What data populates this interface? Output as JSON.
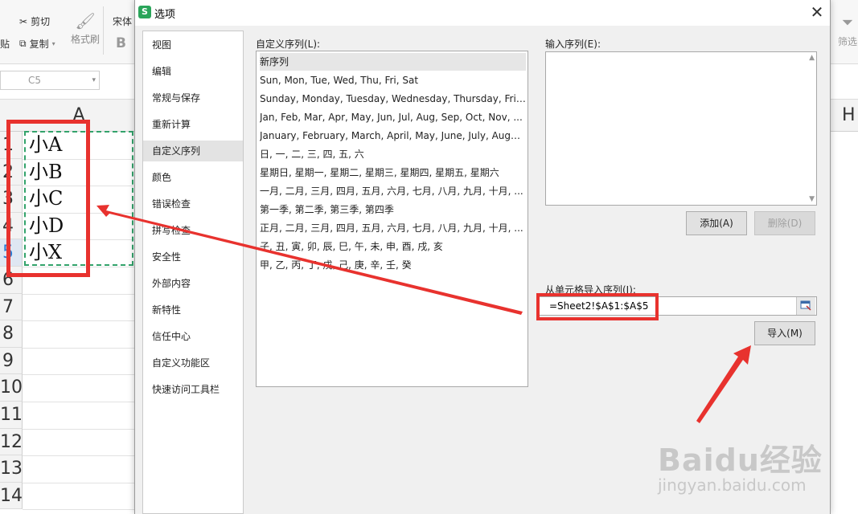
{
  "ribbon": {
    "cut_label": "剪切",
    "copy_label": "复制",
    "format_painter_label": "格式刷",
    "font_name": "宋体",
    "bold_glyph": "B",
    "filter_label": "筛选",
    "paste_fragment": "贴"
  },
  "namebox": {
    "value": "C5"
  },
  "sheet": {
    "column_a": "A",
    "column_h": "H",
    "rows": [
      {
        "num": "1",
        "value": "小A"
      },
      {
        "num": "2",
        "value": "小B"
      },
      {
        "num": "3",
        "value": "小C"
      },
      {
        "num": "4",
        "value": "小D"
      },
      {
        "num": "5",
        "value": "小X"
      },
      {
        "num": "6",
        "value": ""
      },
      {
        "num": "7",
        "value": ""
      },
      {
        "num": "8",
        "value": ""
      },
      {
        "num": "9",
        "value": ""
      },
      {
        "num": "10",
        "value": ""
      },
      {
        "num": "11",
        "value": ""
      },
      {
        "num": "12",
        "value": ""
      },
      {
        "num": "13",
        "value": ""
      },
      {
        "num": "14",
        "value": ""
      }
    ]
  },
  "dialog": {
    "title": "选项",
    "app_icon": "S",
    "close_glyph": "✕",
    "nav": [
      {
        "label": "视图"
      },
      {
        "label": "编辑"
      },
      {
        "label": "常规与保存"
      },
      {
        "label": "重新计算"
      },
      {
        "label": "自定义序列",
        "active": true
      },
      {
        "label": "颜色"
      },
      {
        "label": "错误检查"
      },
      {
        "label": "拼写检查"
      },
      {
        "label": "安全性"
      },
      {
        "label": "外部内容"
      },
      {
        "label": "新特性"
      },
      {
        "label": "信任中心"
      },
      {
        "label": "自定义功能区"
      },
      {
        "label": "快速访问工具栏"
      }
    ],
    "custom_lists_label": "自定义序列(L):",
    "custom_lists": [
      "新序列",
      "Sun, Mon, Tue, Wed, Thu, Fri, Sat",
      "Sunday, Monday, Tuesday, Wednesday, Thursday, Frid...",
      "Jan, Feb, Mar, Apr, May, Jun, Jul, Aug, Sep, Oct, Nov, ...",
      "January, February, March, April, May, June, July, Augus...",
      "日, 一, 二, 三, 四, 五, 六",
      "星期日, 星期一, 星期二, 星期三, 星期四, 星期五, 星期六",
      "一月, 二月, 三月, 四月, 五月, 六月, 七月, 八月, 九月, 十月, ...",
      "第一季, 第二季, 第三季, 第四季",
      "正月, 二月, 三月, 四月, 五月, 六月, 七月, 八月, 九月, 十月, ...",
      "子, 丑, 寅, 卯, 辰, 巳, 午, 未, 申, 酉, 戌, 亥",
      "甲, 乙, 丙, 丁, 戊, 己, 庚, 辛, 壬, 癸"
    ],
    "entries_label": "输入序列(E):",
    "add_button": "添加(A)",
    "delete_button": "删除(D)",
    "import_label": "从单元格导入序列(I):",
    "import_ref": "=Sheet2!$A$1:$A$5",
    "import_button": "导入(M)"
  },
  "watermark": {
    "main": "Baidu经验",
    "sub": "jingyan.baidu.com"
  },
  "colors": {
    "annotation_red": "#e8322e",
    "selection_green": "#33a36b",
    "wps_green": "#2aa55a"
  }
}
